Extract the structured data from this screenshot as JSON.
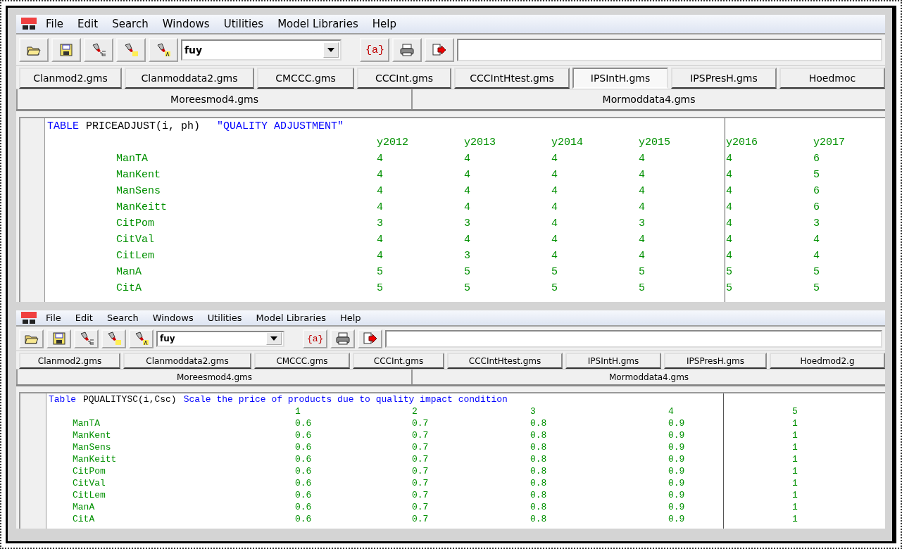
{
  "windows": [
    {
      "menu": [
        "File",
        "Edit",
        "Search",
        "Windows",
        "Utilities",
        "Model Libraries",
        "Help"
      ],
      "search": {
        "value": "fuy"
      },
      "symbol_button": "{a}",
      "tabs": [
        {
          "label": "Clanmod2.gms",
          "selected": false
        },
        {
          "label": "Clanmoddata2.gms",
          "selected": false
        },
        {
          "label": "CMCCC.gms",
          "selected": false
        },
        {
          "label": "CCCInt.gms",
          "selected": false
        },
        {
          "label": "CCCIntHtest.gms",
          "selected": false
        },
        {
          "label": "IPSIntH.gms",
          "selected": true
        },
        {
          "label": "IPSPresH.gms",
          "selected": false
        },
        {
          "label": "Hoedmoc",
          "selected": false
        }
      ],
      "file_tabs": [
        {
          "label": "Moreesmod4.gms",
          "selected": false
        },
        {
          "label": "Mormoddata4.gms",
          "selected": false
        }
      ],
      "editor": {
        "keyword": "TABLE",
        "declaration": "PRICEADJUST(i, ph)",
        "description": "\"QUALITY ADJUSTMENT\"",
        "columns": [
          "y2012",
          "y2013",
          "y2014",
          "y2015",
          "y2016",
          "y2017"
        ],
        "rows": [
          {
            "label": "ManTA",
            "values": [
              "4",
              "4",
              "4",
              "4",
              "4",
              "6"
            ]
          },
          {
            "label": "ManKent",
            "values": [
              "4",
              "4",
              "4",
              "4",
              "4",
              "5"
            ]
          },
          {
            "label": "ManSens",
            "values": [
              "4",
              "4",
              "4",
              "4",
              "4",
              "6"
            ]
          },
          {
            "label": "ManKeitt",
            "values": [
              "4",
              "4",
              "4",
              "4",
              "4",
              "6"
            ]
          },
          {
            "label": "CitPom",
            "values": [
              "3",
              "3",
              "4",
              "3",
              "4",
              "3"
            ]
          },
          {
            "label": "CitVal",
            "values": [
              "4",
              "4",
              "4",
              "4",
              "4",
              "4"
            ]
          },
          {
            "label": "CitLem",
            "values": [
              "4",
              "3",
              "4",
              "4",
              "4",
              "4"
            ]
          },
          {
            "label": "ManA",
            "values": [
              "5",
              "5",
              "5",
              "5",
              "5",
              "5"
            ]
          },
          {
            "label": "CitA",
            "values": [
              "5",
              "5",
              "5",
              "5",
              "5",
              "5"
            ]
          }
        ]
      }
    },
    {
      "menu": [
        "File",
        "Edit",
        "Search",
        "Windows",
        "Utilities",
        "Model Libraries",
        "Help"
      ],
      "search": {
        "value": "fuy"
      },
      "symbol_button": "{a}",
      "tabs": [
        {
          "label": "Clanmod2.gms",
          "selected": false
        },
        {
          "label": "Clanmoddata2.gms",
          "selected": false
        },
        {
          "label": "CMCCC.gms",
          "selected": false
        },
        {
          "label": "CCCInt.gms",
          "selected": false
        },
        {
          "label": "CCCIntHtest.gms",
          "selected": false
        },
        {
          "label": "IPSIntH.gms",
          "selected": false
        },
        {
          "label": "IPSPresH.gms",
          "selected": false
        },
        {
          "label": "Hoedmod2.g",
          "selected": false
        }
      ],
      "file_tabs": [
        {
          "label": "Moreesmod4.gms",
          "selected": false
        },
        {
          "label": "Mormoddata4.gms",
          "selected": false
        }
      ],
      "editor": {
        "keyword": "Table",
        "declaration": "PQUALITYSC(i,Csc)",
        "description": "Scale the price of products due to quality impact condition",
        "columns": [
          "1",
          "2",
          "3",
          "4",
          "5"
        ],
        "rows": [
          {
            "label": "ManTA",
            "values": [
              "0.6",
              "0.7",
              "0.8",
              "0.9",
              "1"
            ]
          },
          {
            "label": "ManKent",
            "values": [
              "0.6",
              "0.7",
              "0.8",
              "0.9",
              "1"
            ]
          },
          {
            "label": "ManSens",
            "values": [
              "0.6",
              "0.7",
              "0.8",
              "0.9",
              "1"
            ]
          },
          {
            "label": "ManKeitt",
            "values": [
              "0.6",
              "0.7",
              "0.8",
              "0.9",
              "1"
            ]
          },
          {
            "label": "CitPom",
            "values": [
              "0.6",
              "0.7",
              "0.8",
              "0.9",
              "1"
            ]
          },
          {
            "label": "CitVal",
            "values": [
              "0.6",
              "0.7",
              "0.8",
              "0.9",
              "1"
            ]
          },
          {
            "label": "CitLem",
            "values": [
              "0.6",
              "0.7",
              "0.8",
              "0.9",
              "1"
            ]
          },
          {
            "label": "ManA",
            "values": [
              "0.6",
              "0.7",
              "0.8",
              "0.9",
              "1"
            ]
          },
          {
            "label": "CitA",
            "values": [
              "0.6",
              "0.7",
              "0.8",
              "0.9",
              "1"
            ]
          }
        ]
      }
    }
  ]
}
